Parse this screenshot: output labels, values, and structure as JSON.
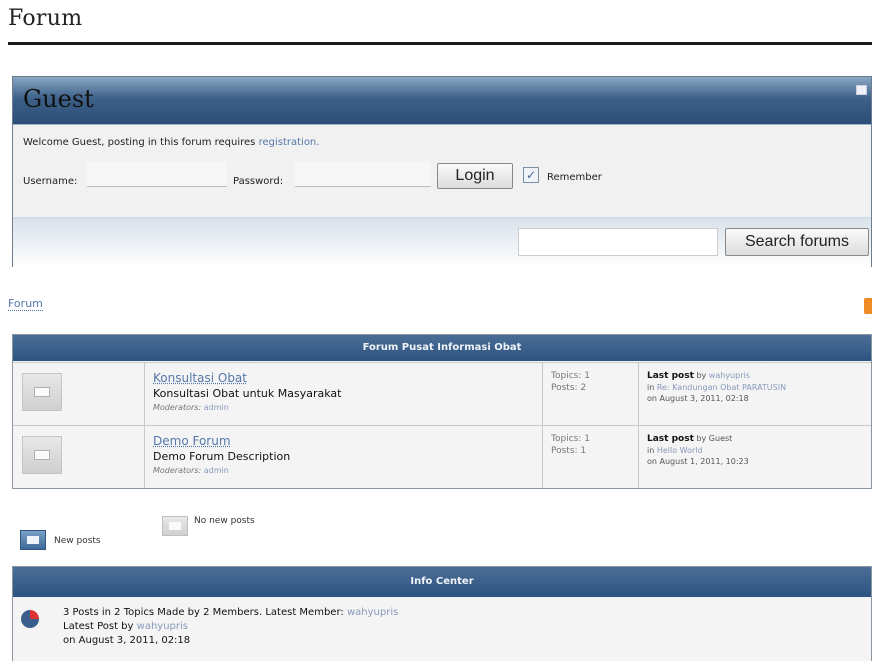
{
  "page": {
    "title": "Forum"
  },
  "guest": {
    "title": "Guest",
    "welcome_text": "Welcome Guest, posting in this forum requires",
    "welcome_link": "registration.",
    "username_label": "Username:",
    "password_label": "Password:",
    "login_label": "Login",
    "remember_label": "Remember",
    "remember_checked": true,
    "search_label": "Search forums",
    "search_value": ""
  },
  "breadcrumb": {
    "label": "Forum"
  },
  "category": {
    "title": "Forum Pusat Informasi Obat",
    "forums": [
      {
        "name": "Konsultasi Obat",
        "description": "Konsultasi Obat untuk Masyarakat",
        "moderators_label": "Moderators:",
        "moderator": "admin",
        "topics": "Topics: 1",
        "posts": "Posts: 2",
        "last_post_label": "Last post",
        "last_post_by_prefix": "by",
        "last_post_by": "wahyupris",
        "last_post_in_prefix": "in",
        "last_post_in": "Re: Kandungan Obat PARATUSIN",
        "last_post_on": "on August 3, 2011, 02:18"
      },
      {
        "name": "Demo Forum",
        "description": "Demo Forum Description",
        "moderators_label": "Moderators:",
        "moderator": "admin",
        "topics": "Topics: 1",
        "posts": "Posts: 1",
        "last_post_label": "Last post",
        "last_post_by_prefix": "by",
        "last_post_by": "Guest",
        "last_post_in_prefix": "in",
        "last_post_in": "Hello World",
        "last_post_on": "on August 1, 2011, 10:23"
      }
    ]
  },
  "legend": {
    "new_posts": "New posts",
    "no_new_posts": "No new posts"
  },
  "info_center": {
    "title": "Info Center",
    "stats_text": "3 Posts in 2 Topics Made by 2 Members. Latest Member:",
    "latest_member": "wahyupris",
    "latest_post_prefix": "Latest Post by",
    "latest_post_by": "wahyupris",
    "latest_post_on": "on August 3, 2011, 02:18"
  },
  "colors": {
    "header_dark": "#2d5380",
    "header_light": "#8aa7c4",
    "link": "#5577aa",
    "rss": "#f08a24"
  },
  "icons": {
    "collapse": "minus-icon",
    "rss": "rss-icon",
    "board": "envelope-icon",
    "stats": "pie-chart-icon"
  }
}
